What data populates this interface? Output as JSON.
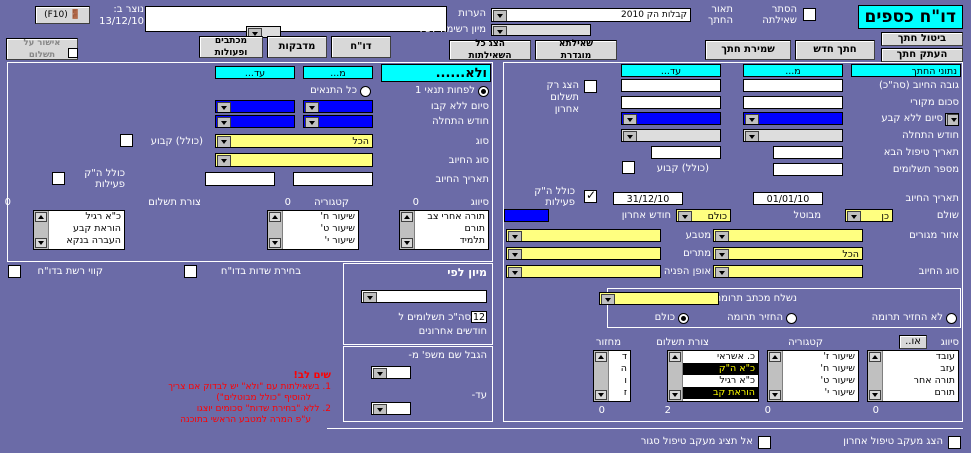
{
  "header": {
    "title": "דו\"ח כספים",
    "hide_label": "הסתר\nשאילתה",
    "desc_label": "תאור\nהחתך",
    "desc_value": "קבלות הק 2010",
    "notes_label": "הערות",
    "created_label": "נוצר ב:",
    "created_date": "13/12/10",
    "exit_label": "(F10)",
    "sort_label": "מיון רשימה לפי:"
  },
  "buttons": {
    "cancel_cut": "ביטול חתך",
    "copy_cut": "העתק חתך",
    "new_cut": "חתך חדש",
    "save_cut": "שמירת חתך",
    "saved_query": "שאילתא\nמוגדרת",
    "show_all": "הצג כל\nהשאילתות",
    "report": "דו\"ח",
    "stickers": "מדבקות",
    "attach": "מדבקות",
    "letters": "מכתבים\nופעולות",
    "approve_pay": "אישור על\nתשלום"
  },
  "toolbar_labels": {
    "b1": "מכתבים\nופעולות",
    "b2": "מדבקות",
    "b3": "דו\"ח"
  },
  "right_panel": {
    "title": "נתוני החתך",
    "from": "מ...",
    "to": "עד...",
    "rows": [
      "גובה החיוב (סה\"כ)",
      "סכום מקורי",
      "סיום ללא קבע",
      "חודש התחלה",
      "תאריך טיפול הבא",
      "מספר תשלומים"
    ],
    "show_last": "הצג רק\nתשלום\nאחרון",
    "incl_fixed": "(כולל) קבוע",
    "bill_date": "תאריך החיוב",
    "date_from": "01/01/10",
    "date_to": "31/12/10",
    "incl_hak": "כולל ה\"ק\nפעילות",
    "paid": "שולם",
    "paid_val": "כן",
    "cancelled": "מבוטל",
    "cancelled_val": "כולם",
    "last_month": "חודש אחרון",
    "area": "אזור מגורים",
    "currency": "מטבע",
    "donors": "מתרים",
    "bill_type": "סוג החיוב",
    "bill_type_val": "הכל",
    "referral": "אופן הפניה",
    "send_letter": "נשלח מכתב תרומה",
    "radio_no": "לא החזיר תרומה",
    "radio_ret": "החזיר תרומה",
    "radio_all": "כולם"
  },
  "class_row": {
    "siyug": "סיווג",
    "siyug_btn": "או..",
    "category": "קטגוריה",
    "pay_form": "צורת תשלום",
    "period": "מחזור"
  },
  "lists": {
    "siyug": [
      "עובד",
      "עזב",
      "תורה אחר",
      "תורם"
    ],
    "category": [
      "שיעור ז'",
      "שיעור ח'",
      "שיעור ט'",
      "שיעור י'"
    ],
    "pay_form": [
      "כ. אשראי",
      "כ\"א ה\"ק",
      "כ\"א רגיל",
      "הוראת קב"
    ],
    "period": [
      "ד",
      "ה",
      "ו",
      "ז"
    ],
    "counts": [
      "0",
      "0",
      "2",
      "0"
    ]
  },
  "left_panel": {
    "title": "ולא......",
    "from": "מ...",
    "to": "עד...",
    "r_all": "לפחות תנאי 1",
    "r_all2": "כל התנאים",
    "rows": [
      "סיום ללא קבו",
      "חודש התחלה"
    ],
    "type": "סוג",
    "type_val": "הכל",
    "incl_fixed": "(כולל) קבוע",
    "bill_type": "סוג החיוב",
    "bill_date": "תאריך החיוב",
    "incl_hak": "כולל ה\"ק\nפעילות",
    "siyug": "סיווג",
    "category": "קטגוריה",
    "pay_form": "צורת תשלום",
    "l1": [
      "תורה אחרי צב",
      "תורם",
      "תלמיד"
    ],
    "l2": [
      "שיעור ח'",
      "שיעור ט'",
      "שיעור י'"
    ],
    "l3": [
      "כ\"א רגיל",
      "הוראת קבע",
      "העברה בנקא"
    ],
    "c1": "0",
    "c2": "0",
    "c3": "0"
  },
  "bottom": {
    "choose_fields": "בחירת שדות בדו\"ח",
    "lines": "קווי רשת בדו\"ח",
    "sort_by": "מיון לפי",
    "total_pay": "סה\"כ תשלומים ל",
    "months": "12",
    "last_months": "חודשים אחרונים",
    "limit": "הגבל שם משפ' מ-",
    "until": "עד-",
    "note_title": "שים לב!",
    "note1": "1. בשאילתות עם \"ולא\" יש לבדוק אם צריך",
    "note1b": "להוסיף \"כולל מבוטלים\")",
    "note2": "2. ללא \"בחירת שדות\" סכומים יוצגו",
    "note2b": "ע\"פ המרה למטבע הראשי בתוכנה",
    "show_followup": "הצג מעקב טיפול אחרון",
    "hide_closed": "אל תציג מעקב טיפול סגור"
  }
}
